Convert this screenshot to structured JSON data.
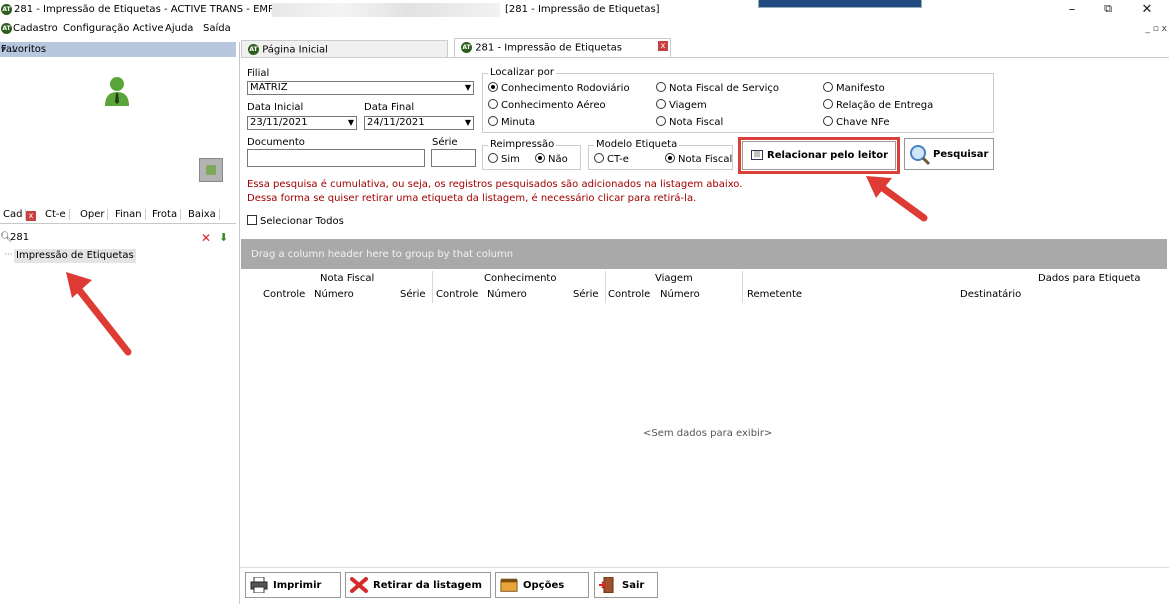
{
  "window": {
    "title_left": "281 - Impressão de Etiquetas - ACTIVE TRANS - EMPRESA:",
    "title_right": "[281 - Impressão de Etiquetas]",
    "controls": [
      "–",
      "⧉",
      "✕"
    ]
  },
  "menu": {
    "items": [
      "Cadastro",
      "Configuração Active",
      "Ajuda",
      "Saída"
    ],
    "mdi_controls": "_ ▫ x"
  },
  "sidebar": {
    "favorites_title": "Favoritos",
    "tabs": [
      "Cad",
      "Ct-e",
      "Oper",
      "Finan",
      "Frota",
      "Baixa"
    ],
    "search_value": "281",
    "tree_item": "Impressão de Etiquetas"
  },
  "tabs": {
    "home": "Página Inicial",
    "current": "281 - Impressão de Etiquetas",
    "close_glyph": "x"
  },
  "form": {
    "filial_label": "Filial",
    "filial_value": "MATRIZ",
    "data_inicial_label": "Data Inicial",
    "data_inicial_value": "23/11/2021",
    "data_final_label": "Data Final",
    "data_final_value": "24/11/2021",
    "documento_label": "Documento",
    "serie_label": "Série",
    "localizar_title": "Localizar por",
    "localizar_options": [
      "Conhecimento Rodoviário",
      "Conhecimento Aéreo",
      "Minuta",
      "Nota Fiscal de Serviço",
      "Viagem",
      "Nota Fiscal",
      "Manifesto",
      "Relação de Entrega",
      "Chave NFe"
    ],
    "localizar_selected": 0,
    "reimpressao_title": "Reimpressão",
    "reimpressao_options": [
      "Sim",
      "Não"
    ],
    "reimpressao_selected": 1,
    "modelo_title": "Modelo Etiqueta",
    "modelo_options": [
      "CT-e",
      "Nota Fiscal"
    ],
    "modelo_selected": 1,
    "relacionar_button": "Relacionar pelo leitor",
    "pesquisar_button": "Pesquisar",
    "warning_line1": "Essa pesquisa é cumulativa, ou seja, os registros pesquisados são adicionados na listagem abaixo.",
    "warning_line2": "Dessa forma se quiser retirar uma etiqueta da listagem, é necessário clicar para retirá-la.",
    "selecionar_todos": "Selecionar Todos"
  },
  "grid": {
    "group_hint": "Drag a column header here to group by that column",
    "bands": [
      "Nota Fiscal",
      "Conhecimento",
      "Viagem",
      "Dados para Etiqueta"
    ],
    "columns": [
      "Controle",
      "Número",
      "Série",
      "Controle",
      "Número",
      "Série",
      "Controle",
      "Número",
      "Remetente",
      "Destinatário"
    ],
    "empty_text": "<Sem dados para exibir>"
  },
  "footer": {
    "imprimir": "Imprimir",
    "retirar": "Retirar da listagem",
    "opcoes": "Opções",
    "sair": "Sair"
  },
  "colors": {
    "highlight": "#d9403a",
    "warning": "#a00000",
    "group_bar": "#a9a9a9",
    "favorites_header": "#b7c7dd"
  }
}
